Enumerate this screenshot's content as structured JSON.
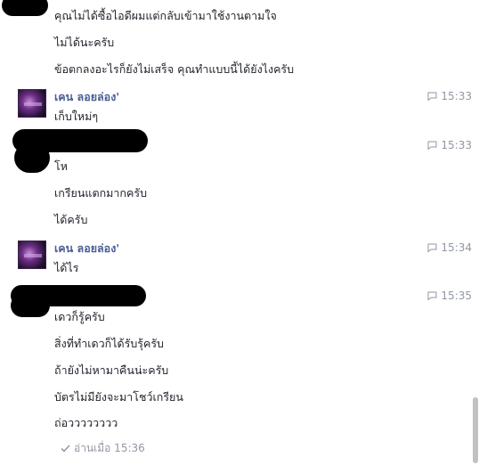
{
  "messages": {
    "m1": "คุณไม่ได้ซื้อไอดีผมแต่กลับเข้ามาใช้งานตามใจ",
    "m2": "ไม่ได้นะครับ",
    "m3": "ข้อตกลงอะไรก็ยังไม่เสร็จ คุณทำแบบนี้ได้ยังไงครับ",
    "m4": "เก็บใหม่ๆ",
    "m5": "โห",
    "m6": "เกรียนแตกมากครับ",
    "m7": "ได้ครับ",
    "m8": "ได้ไร",
    "m9": "เดวก็รู้ครับ",
    "m10": "สิ่งที่ทำเดวก็ได้รับรุ้ครับ",
    "m11": "ถ้ายังไม่หามาคืนน่ะครับ",
    "m12": "บัตรไม่มียังจะมาโชว์เกรียน",
    "m13": "ถ่อวววววววว"
  },
  "senders": {
    "ken1": "เคน ลอยล่อง'",
    "ken2": "เคน ลอยล่อง'"
  },
  "times": {
    "t1": "15:33",
    "t2": "15:33",
    "t3": "15:34",
    "t4": "15:35"
  },
  "seen": {
    "label": "อ่านเมื่อ 15:36"
  },
  "icons": {
    "timestamp": "chat-bubble-icon",
    "seen": "check-icon"
  },
  "colors": {
    "sender_name": "#4a5e94",
    "timestamp": "#9197a3",
    "message_text": "#1d2129"
  }
}
